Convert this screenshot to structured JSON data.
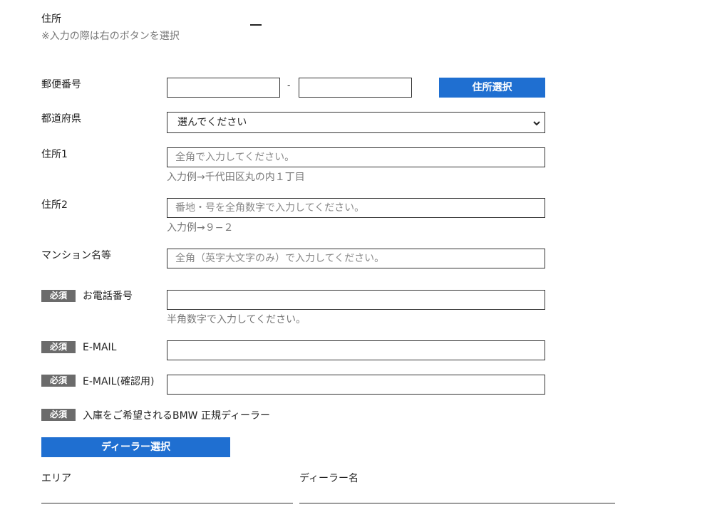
{
  "address_section": {
    "title": "住所",
    "note": "※入力の際は右のボタンを選択"
  },
  "postal": {
    "label": "郵便番号",
    "separator": "-",
    "part1_value": "",
    "part2_value": "",
    "lookup_button": "住所選択"
  },
  "prefecture": {
    "label": "都道府県",
    "selected": "選んでください"
  },
  "address1": {
    "label": "住所1",
    "placeholder": "全角で入力してください。",
    "hint": "入力例→千代田区丸の内１丁目"
  },
  "address2": {
    "label": "住所2",
    "placeholder": "番地・号を全角数字で入力してください。",
    "hint": "入力例→９−２"
  },
  "mansion": {
    "label": "マンション名等",
    "placeholder": "全角（英字大文字のみ）で入力してください。"
  },
  "required_badge": "必須",
  "phone": {
    "label": "お電話番号",
    "value": "",
    "hint": "半角数字で入力してください。"
  },
  "email": {
    "label": "E-MAIL",
    "value": ""
  },
  "email_confirm": {
    "label": "E-MAIL(確認用)",
    "value": ""
  },
  "dealer": {
    "label": "入庫をご希望されるBMW 正規ディーラー",
    "select_button": "ディーラー選択",
    "area_label": "エリア",
    "dealer_name_label": "ディーラー名"
  },
  "colors": {
    "accent": "#1f6fd1",
    "badge": "#6b6b6b"
  }
}
